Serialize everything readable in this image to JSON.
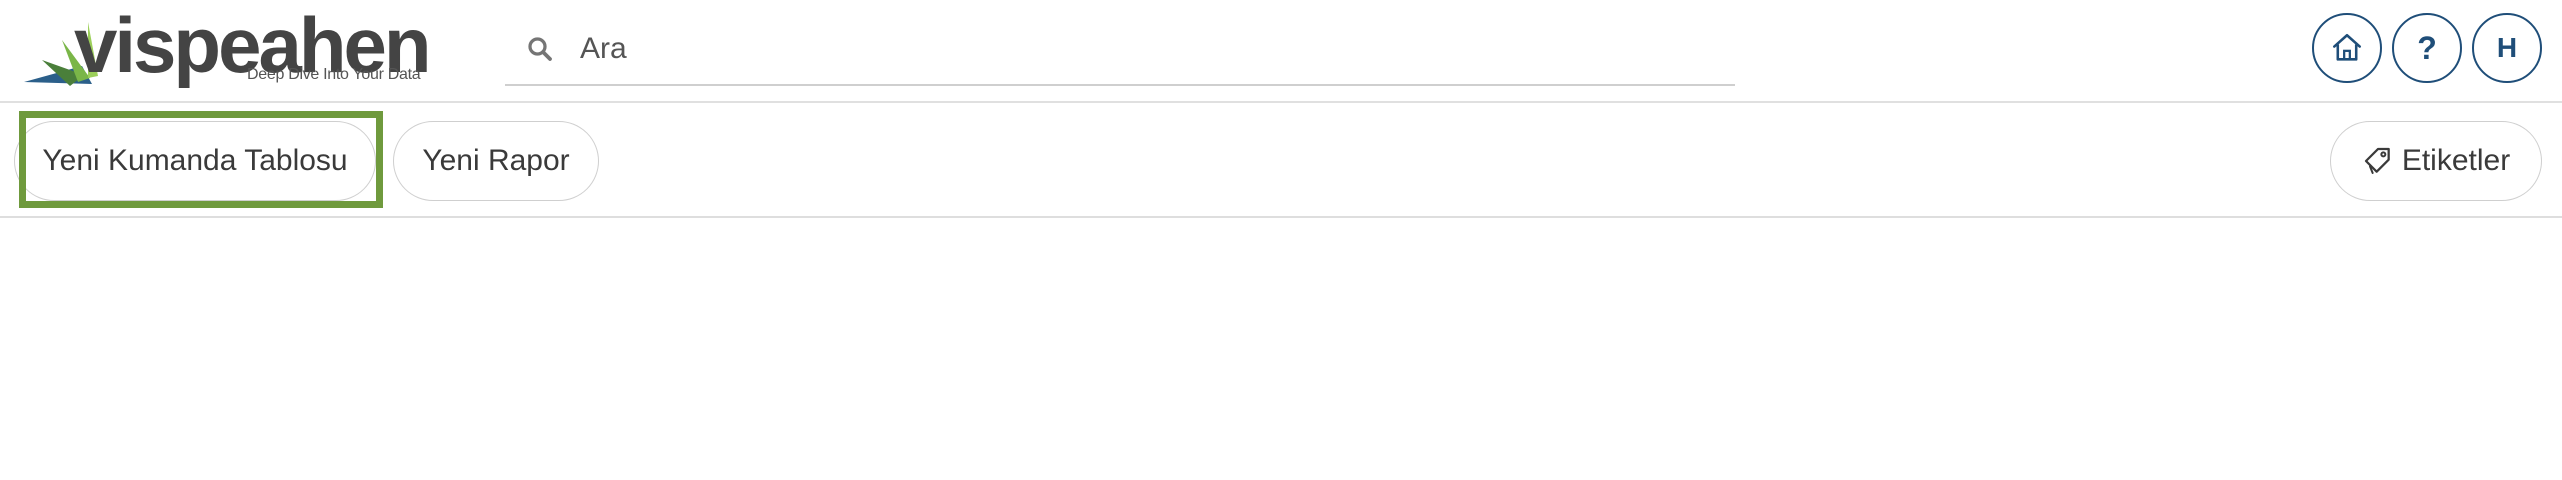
{
  "header": {
    "logo": {
      "name": "vispeahen",
      "tagline": "Deep Dive Into Your Data"
    },
    "search": {
      "placeholder": "Ara",
      "icon": "search-icon"
    },
    "buttons": {
      "home_icon": "home-icon",
      "help_label": "?",
      "user_initial": "H"
    }
  },
  "actions": {
    "new_dashboard_label": "Yeni Kumanda Tablosu",
    "new_report_label": "Yeni Rapor",
    "tags_label": "Etiketler",
    "tags_icon": "tag-icon",
    "highlight_color": "#6f9a3d"
  },
  "colors": {
    "accent": "#1f4e79",
    "logo_green": "#7ab648",
    "logo_blue": "#2b5f8a",
    "text": "#3a3a3a"
  }
}
